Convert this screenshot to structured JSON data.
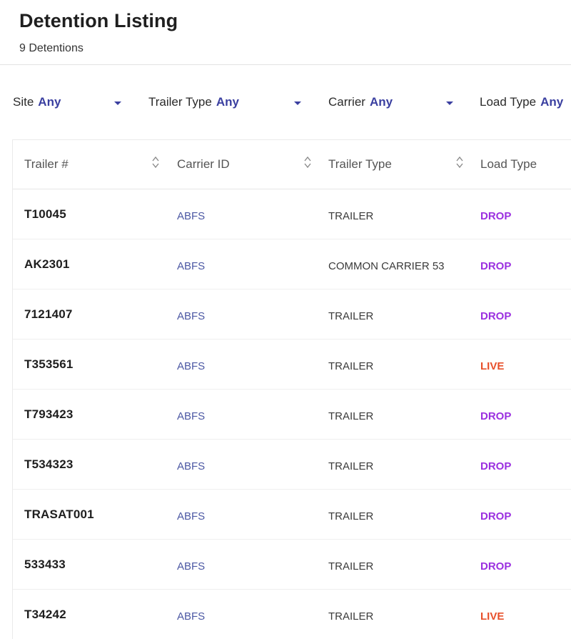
{
  "page": {
    "title": "Detention Listing",
    "subtitle": "9 Detentions"
  },
  "filters": [
    {
      "label": "Site",
      "value": "Any"
    },
    {
      "label": "Trailer Type",
      "value": "Any"
    },
    {
      "label": "Carrier",
      "value": "Any"
    },
    {
      "label": "Load Type",
      "value": "Any"
    }
  ],
  "table": {
    "columns": [
      "Trailer #",
      "Carrier ID",
      "Trailer Type",
      "Load Type"
    ],
    "rows": [
      {
        "trailer": "T10045",
        "carrier": "ABFS",
        "trailer_type": "TRAILER",
        "load_type": "DROP"
      },
      {
        "trailer": "AK2301",
        "carrier": "ABFS",
        "trailer_type": "COMMON CARRIER 53",
        "load_type": "DROP"
      },
      {
        "trailer": "7121407",
        "carrier": "ABFS",
        "trailer_type": "TRAILER",
        "load_type": "DROP"
      },
      {
        "trailer": "T353561",
        "carrier": "ABFS",
        "trailer_type": "TRAILER",
        "load_type": "LIVE"
      },
      {
        "trailer": "T793423",
        "carrier": "ABFS",
        "trailer_type": "TRAILER",
        "load_type": "DROP"
      },
      {
        "trailer": "T534323",
        "carrier": "ABFS",
        "trailer_type": "TRAILER",
        "load_type": "DROP"
      },
      {
        "trailer": "TRASAT001",
        "carrier": "ABFS",
        "trailer_type": "TRAILER",
        "load_type": "DROP"
      },
      {
        "trailer": "533433",
        "carrier": "ABFS",
        "trailer_type": "TRAILER",
        "load_type": "DROP"
      },
      {
        "trailer": "T34242",
        "carrier": "ABFS",
        "trailer_type": "TRAILER",
        "load_type": "LIVE"
      }
    ]
  },
  "colors": {
    "drop": "#9b30e0",
    "live": "#e8502b",
    "accent": "#3a3fa0"
  },
  "icons": {
    "sort": "sort-arrows-icon",
    "dropdown": "chevron-down-icon"
  }
}
